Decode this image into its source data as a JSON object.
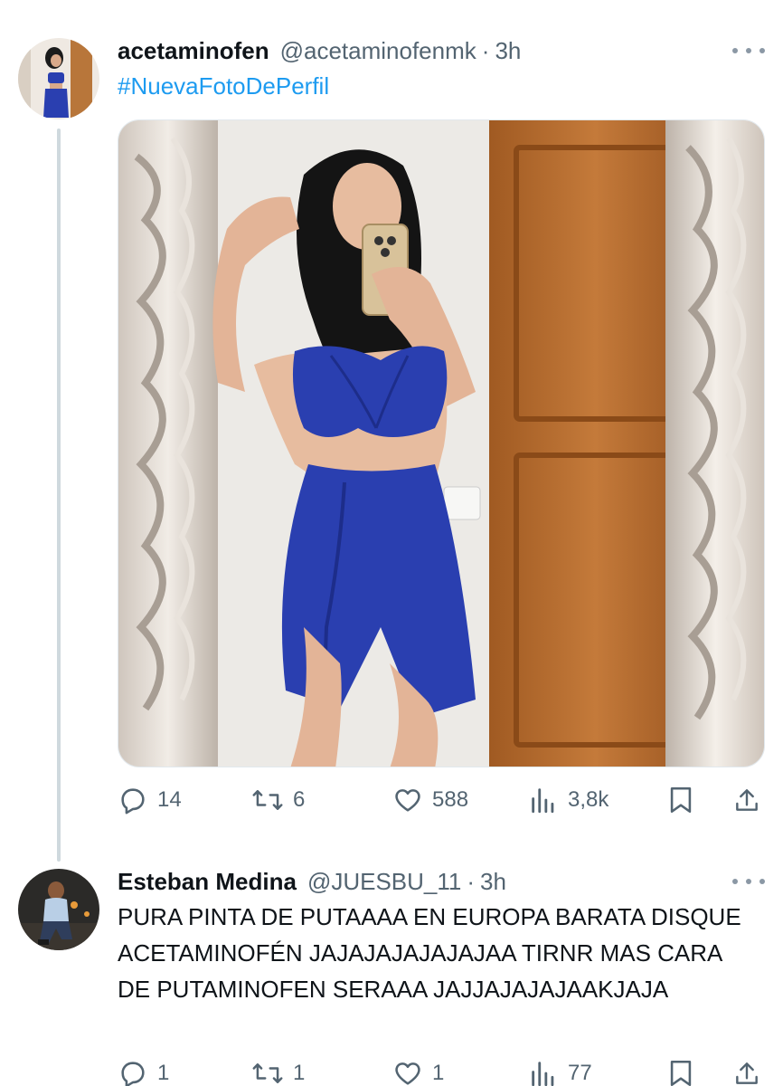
{
  "tweets": [
    {
      "name": "acetaminofen",
      "handle": "@acetaminofenmk",
      "separator": "·",
      "time": "3h",
      "hashtag": "#NuevaFotoDePerfil",
      "stats": {
        "replies": "14",
        "reposts": "6",
        "likes": "588",
        "views": "3,8k"
      }
    },
    {
      "name": "Esteban Medina",
      "handle": "@JUESBU_11",
      "separator": "·",
      "time": "3h",
      "text": "PURA PINTA DE PUTAAAA EN EUROPA BARATA DISQUE ACETAMINOFÉN JAJAJAJAJAJAJAA TIRNR MAS CARA DE PUTAMINOFEN SERAAA JAJJAJAJAJAAKJAJA",
      "stats": {
        "replies": "1",
        "reposts": "1",
        "likes": "1",
        "views": "77"
      }
    }
  ],
  "colors": {
    "link": "#1d9bf0",
    "secondary": "#536471",
    "dress": "#2a3fb0"
  }
}
